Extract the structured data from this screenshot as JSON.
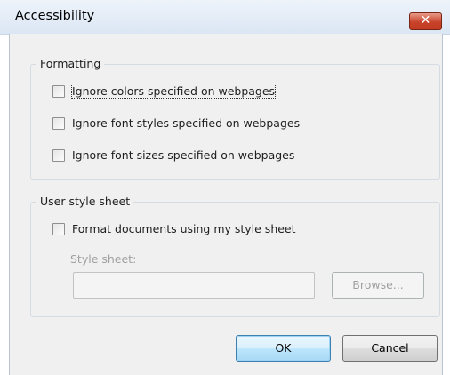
{
  "window": {
    "title": "Accessibility",
    "close_glyph": "✕",
    "close_icon": "close-icon"
  },
  "formatting": {
    "legend": "Formatting",
    "options": [
      {
        "label": "Ignore colors specified on webpages",
        "checked": false
      },
      {
        "label": "Ignore font styles specified on webpages",
        "checked": false
      },
      {
        "label": "Ignore font sizes specified on webpages",
        "checked": false
      }
    ]
  },
  "user_style_sheet": {
    "legend": "User style sheet",
    "format_option": {
      "label": "Format documents using my style sheet",
      "checked": false
    },
    "style_sheet_label": "Style sheet:",
    "style_sheet_value": "",
    "browse_label": "Browse..."
  },
  "buttons": {
    "ok": "OK",
    "cancel": "Cancel"
  }
}
